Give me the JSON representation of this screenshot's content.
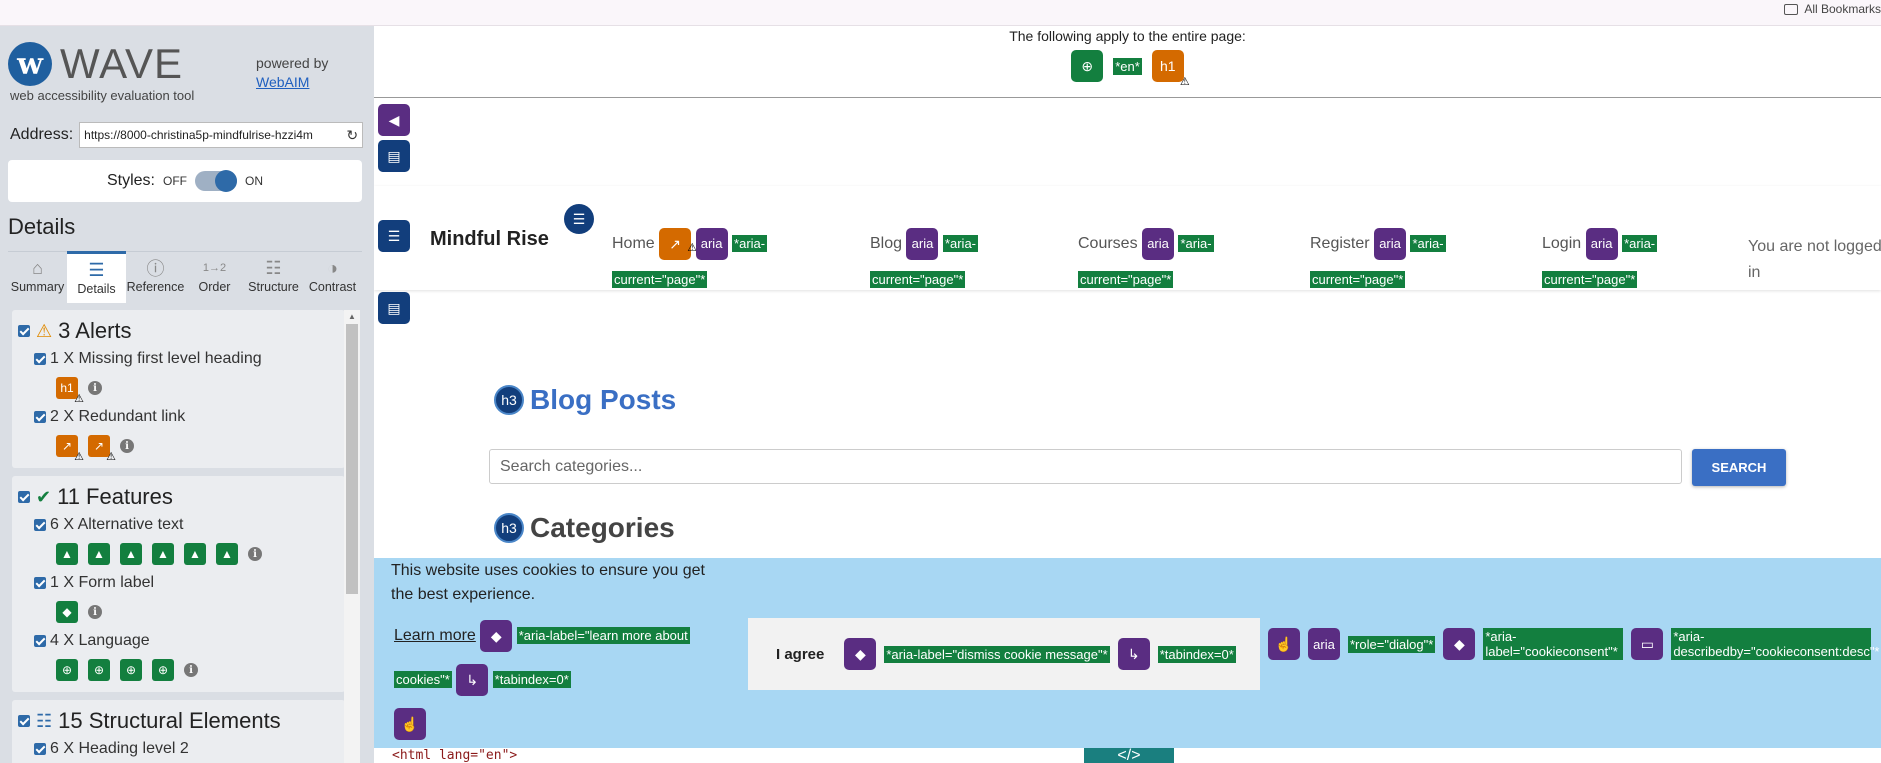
{
  "bookmarks": {
    "label": "All Bookmarks"
  },
  "sidebar": {
    "logo_text": "WAVE",
    "logo_sub": "web accessibility evaluation tool",
    "powered_by": "powered by",
    "webaim_link": "WebAIM",
    "address_label": "Address:",
    "address_value": "https://8000-christina5p-mindfulrise-hzzi4m",
    "styles_label": "Styles:",
    "styles_off": "OFF",
    "styles_on": "ON",
    "details_heading": "Details",
    "tabs": [
      {
        "label": "Summary",
        "icon": "home-icon"
      },
      {
        "label": "Details",
        "icon": "list-icon"
      },
      {
        "label": "Reference",
        "icon": "info-icon"
      },
      {
        "label": "Order",
        "icon": "order-icon"
      },
      {
        "label": "Structure",
        "icon": "structure-icon"
      },
      {
        "label": "Contrast",
        "icon": "contrast-icon"
      }
    ],
    "alerts": {
      "title": "3 Alerts",
      "items": [
        {
          "label": "1 X Missing first level heading"
        },
        {
          "label": "2 X Redundant link"
        }
      ]
    },
    "features": {
      "title": "11 Features",
      "items": [
        {
          "label": "6 X Alternative text"
        },
        {
          "label": "1 X Form label"
        },
        {
          "label": "4 X Language"
        }
      ]
    },
    "structural": {
      "title": "15 Structural Elements",
      "items": [
        {
          "label": "6 X Heading level 2"
        }
      ]
    }
  },
  "main": {
    "apply_text": "The following apply to the entire page:",
    "lang_tag": "*en*",
    "h1_badge": "h1",
    "aria_badge": "aria",
    "brand": "Mindful Rise",
    "nav": [
      {
        "label": "Home",
        "tag1": "*aria-",
        "tag2": "current=\"page\"*"
      },
      {
        "label": "Blog",
        "tag1": "*aria-",
        "tag2": "current=\"page\"*"
      },
      {
        "label": "Courses",
        "tag1": "*aria-",
        "tag2": "current=\"page\"*"
      },
      {
        "label": "Register",
        "tag1": "*aria-",
        "tag2": "current=\"page\"*"
      },
      {
        "label": "Login",
        "tag1": "*aria-",
        "tag2": "current=\"page\"*"
      }
    ],
    "not_logged": "You are not logged in",
    "h3_badge": "h3",
    "blog_heading": "Blog Posts",
    "search_placeholder": "Search categories...",
    "search_button": "SEARCH",
    "categories_heading": "Categories",
    "cookie": {
      "message": "This website uses cookies to ensure you get the best experience.",
      "learn_more": "Learn more",
      "learn_tag1": "*aria-label=\"learn more about",
      "learn_tag2": "cookies\"*",
      "tabindex_tag": "*tabindex=0*",
      "agree": "I agree",
      "dismiss_tag": "*aria-label=\"dismiss cookie message\"*",
      "role_tag": "*role=\"dialog\"*",
      "label_tag": "*aria-label=\"cookieconsent\"*",
      "describedby_tag": "*aria-describedby=\"cookieconsent:desc\"*"
    },
    "code_text": "<html lang=\"en\">",
    "code_button": "</>"
  }
}
